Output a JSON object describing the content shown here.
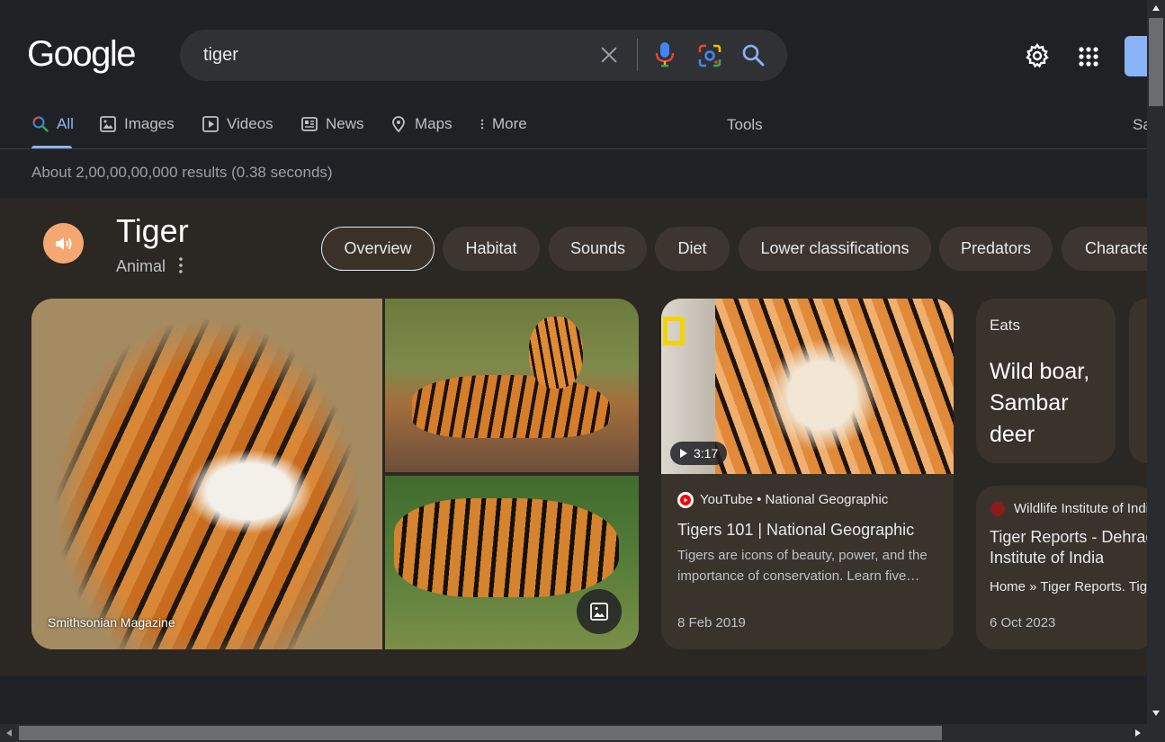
{
  "header": {
    "logo_text": "Google",
    "search_value": "tiger"
  },
  "nav": {
    "tabs": [
      {
        "label": "All",
        "icon": "search-icon",
        "active": true
      },
      {
        "label": "Images",
        "icon": "image-icon"
      },
      {
        "label": "Videos",
        "icon": "play-icon"
      },
      {
        "label": "News",
        "icon": "news-icon"
      },
      {
        "label": "Maps",
        "icon": "map-pin-icon"
      },
      {
        "label": "More",
        "icon": "more-vert-icon"
      }
    ],
    "tools_label": "Tools",
    "safesearch_partial": "Sa"
  },
  "result_stats": "About 2,00,00,00,000 results (0.38 seconds)",
  "knowledge_panel": {
    "title": "Tiger",
    "subtitle": "Animal",
    "chips": [
      "Overview",
      "Habitat",
      "Sounds",
      "Diet",
      "Lower classifications",
      "Predators",
      "Characte"
    ],
    "active_chip": "Overview",
    "image_caption": "Smithsonian Magazine",
    "video": {
      "duration": "3:17",
      "source": "YouTube • National Geographic",
      "title": "Tigers 101 | National Geographic",
      "snippet": "Tigers are icons of beauty, power, and the importance of conservation. Learn five…",
      "date": "8 Feb 2019"
    },
    "eats": {
      "label": "Eats",
      "value": "Wild boar, Sambar deer"
    },
    "article": {
      "source": "Wildlife Institute of India",
      "title": "Tiger Reports - Dehradun Institute of India",
      "title_line1": "Tiger Reports - Dehrac",
      "title_line2": "Institute of India",
      "snippet": "Home » Tiger Reports. Tig",
      "date": "6 Oct 2023"
    }
  },
  "colors": {
    "background": "#202124",
    "accent": "#8ab4f8",
    "panel": "#2b2722",
    "card": "#3a332c",
    "speaker": "#f5a772"
  }
}
